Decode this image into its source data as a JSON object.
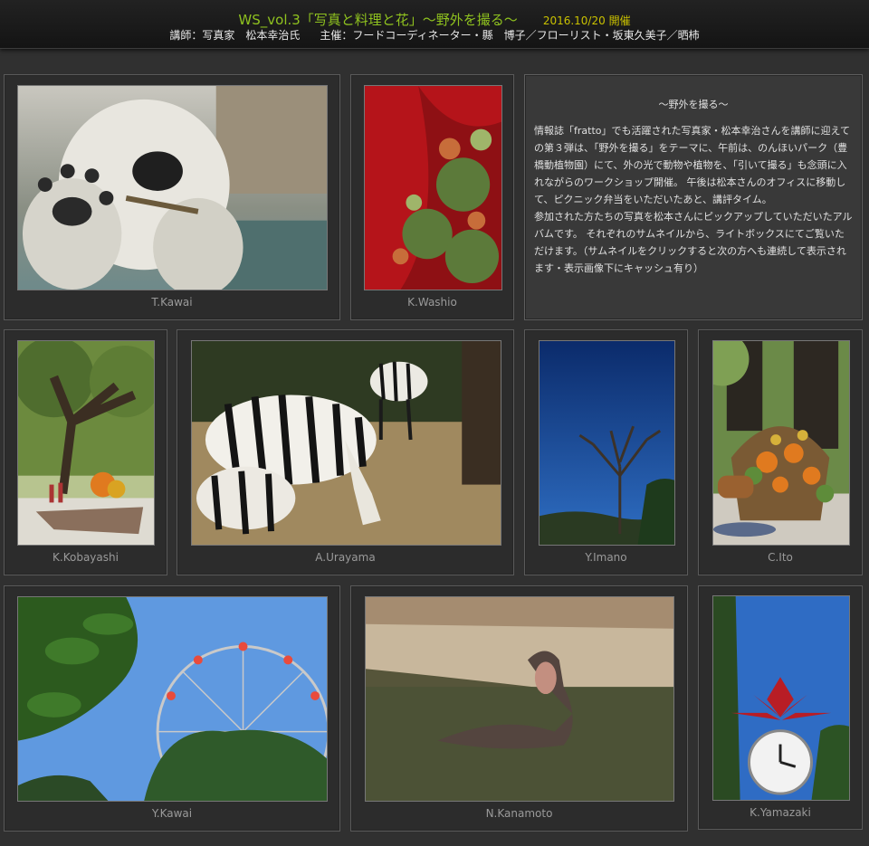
{
  "header": {
    "title": "WS_vol.3「写真と料理と花」～野外を撮る～",
    "date": "2016.10/20 開催",
    "instructor": "講師：写真家　松本幸治氏",
    "organizer": "主催：フードコーディネーター・縣　博子／フローリスト・坂東久美子／晒柿"
  },
  "description": {
    "heading": "～野外を撮る～",
    "paragraph1": "情報誌「fratto」でも活躍された写真家・松本幸治さんを講師に迎えての第３弾は、「野外を撮る」をテーマに、午前は、のんほいパーク（豊橋動植物園）にて、外の光で動物や植物を、「引いて撮る」も念頭に入れながらのワークショップ開催。 午後は松本さんのオフィスに移動して、ピクニック弁当をいただいたあと、講評タイム。",
    "paragraph2": "参加された方たちの写真を松本さんにピックアップしていただいたアルバムです。 それぞれのサムネイルから、ライトボックスにてご覧いただけます。（サムネイルをクリックすると次の方へも連続して表示されます・表示画像下にキャッシュ有り）"
  },
  "photos": [
    {
      "photographer": "T.Kawai",
      "subject": "polar bear"
    },
    {
      "photographer": "K.Washio",
      "subject": "succulents on red wall"
    },
    {
      "photographer": "K.Kobayashi",
      "subject": "picnic under tree"
    },
    {
      "photographer": "A.Urayama",
      "subject": "zebras grazing"
    },
    {
      "photographer": "Y.Imano",
      "subject": "bare tree and blue sky"
    },
    {
      "photographer": "C.Ito",
      "subject": "flower basket picnic"
    },
    {
      "photographer": "Y.Kawai",
      "subject": "ferris wheel"
    },
    {
      "photographer": "N.Kanamoto",
      "subject": "hippo in water"
    },
    {
      "photographer": "K.Yamazaki",
      "subject": "lotus flower and clock"
    }
  ],
  "colors": {
    "title": "#8fc21f",
    "date": "#c9c100",
    "background": "#303030"
  }
}
